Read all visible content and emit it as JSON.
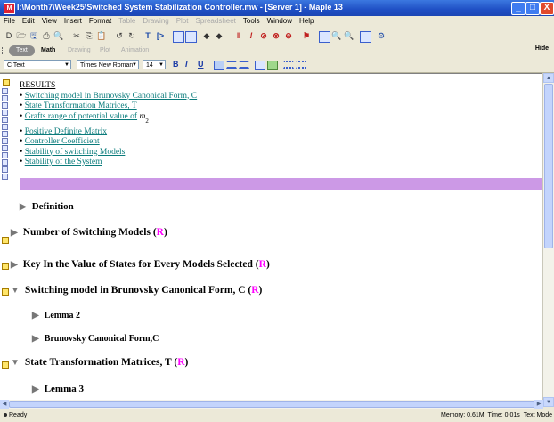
{
  "window": {
    "title": "I:\\Month7\\Week25\\Switched System Stabilization Controller.mw - [Server 1] - Maple 13",
    "icon_label": "M",
    "controls": [
      "minimize-icon",
      "maximize-icon",
      "close-icon"
    ],
    "control_glyphs": [
      "_",
      "□",
      "X"
    ]
  },
  "menu": {
    "items": [
      {
        "label": "File",
        "enabled": true
      },
      {
        "label": "Edit",
        "enabled": true
      },
      {
        "label": "View",
        "enabled": true
      },
      {
        "label": "Insert",
        "enabled": true
      },
      {
        "label": "Format",
        "enabled": true
      },
      {
        "label": "Table",
        "enabled": false
      },
      {
        "label": "Drawing",
        "enabled": false
      },
      {
        "label": "Plot",
        "enabled": false
      },
      {
        "label": "Spreadsheet",
        "enabled": false
      },
      {
        "label": "Tools",
        "enabled": true
      },
      {
        "label": "Window",
        "enabled": true
      },
      {
        "label": "Help",
        "enabled": true
      }
    ]
  },
  "toolbar": {
    "glyph_new": "D",
    "glyph_open": "🗁",
    "glyph_save": "🖫",
    "glyph_print": "⎙",
    "glyph_preview": "🔍",
    "glyph_cut": "✂",
    "glyph_copy": "⎘",
    "glyph_paste": "📋",
    "glyph_undo": "↺",
    "glyph_redo": "↻",
    "glyph_text": "T",
    "glyph_prompt": "[>",
    "glyph_exec": "!",
    "glyph_stop": "⊘",
    "glyph_debug": "⚑",
    "glyph_zoom": "🔍",
    "icons": [
      "new-document",
      "open-folder",
      "save",
      "print",
      "print-preview",
      "cut",
      "copy",
      "paste",
      "undo",
      "redo",
      "text-mode",
      "math-prompt",
      "expand-section",
      "collapse-section",
      "back",
      "forward",
      "restart",
      "execute",
      "stop",
      "debug",
      "zoom-100",
      "zoom-in",
      "zoom-out",
      "page-width",
      "help"
    ]
  },
  "palette_tabs": {
    "items": [
      {
        "label": "Text",
        "active": true
      },
      {
        "label": "Math",
        "active": false,
        "bold": true
      },
      {
        "label": "Drawing",
        "active": false
      },
      {
        "label": "Plot",
        "active": false
      },
      {
        "label": "Animation",
        "active": false
      }
    ],
    "hide_label": "Hide"
  },
  "format": {
    "style_value": "C Text",
    "font_value": "Times New Roman",
    "size_value": "14",
    "bold_label": "B",
    "italic_label": "I",
    "underline_label": "U"
  },
  "document": {
    "results_header": "RESULTS",
    "result_links": [
      "Switching model in Brunovsky Canonical Form, C",
      "State Transformation Matrices, T",
      "Grafts range of potential value of",
      "Positive Definite Matrix",
      "Controller Coefficient",
      "Stability of switching Models",
      "Stability of the System"
    ],
    "bullet": "•",
    "math_symbol": "m",
    "math_subscript": "2",
    "r_label": "R",
    "sections": [
      {
        "label": "Definition",
        "level": 1,
        "expanded": false,
        "r": false,
        "exec": false
      },
      {
        "label": "Number of Switching Models",
        "level": 1,
        "expanded": false,
        "r": true,
        "exec": true
      },
      {
        "label": "Key In the Value of States for Every Models Selected",
        "level": 1,
        "expanded": false,
        "r": true,
        "exec": true
      },
      {
        "label": "Switching model in Brunovsky Canonical Form, C",
        "level": 1,
        "expanded": true,
        "r": true,
        "exec": true
      },
      {
        "label": "Lemma 2",
        "level": 2,
        "expanded": false,
        "r": false,
        "exec": false
      },
      {
        "label": "Brunovsky Canonical Form,C",
        "level": 2,
        "expanded": false,
        "r": false,
        "exec": false
      },
      {
        "label": "State Transformation Matrices, T",
        "level": 1,
        "expanded": true,
        "r": true,
        "exec": true
      },
      {
        "label": "Lemma 3",
        "level": 2,
        "expanded": false,
        "r": false,
        "exec": false
      }
    ]
  },
  "status": {
    "ready": "Ready",
    "memory": "Memory: 0.61M",
    "time": "Time: 0.01s",
    "mode": "Text Mode"
  },
  "colors": {
    "title_bar": "#1f4fc4",
    "link": "#0a7b7b",
    "r_marker": "#ff00ff",
    "purple_band": "#cc99e6",
    "exec_marker": "#ffe66a"
  }
}
